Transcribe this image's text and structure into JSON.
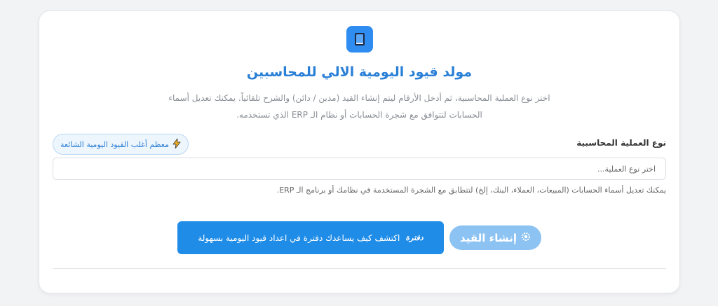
{
  "header": {
    "title": "مولد قيود اليومية الالي للمحاسبين",
    "description_line1": "اختر نوع العملية المحاسبية، ثم أدخل الأرقام ليتم إنشاء القيد (مدين / دائن) والشرح تلقائياً. يمكنك تعديل أسماء",
    "description_line2": "الحسابات لتتوافق مع شجرة الحسابات أو نظام الـ ERP الذي تستخدمه."
  },
  "form": {
    "field_label": "نوع العملية المحاسبية",
    "common_button_label": "معظم أغلب القيود اليومية الشائعة",
    "select_value": "اختر نوع العملية...",
    "hint": "يمكنك تعديل أسماء الحسابات (المبيعات، العملاء، البنك، إلخ) لتتطابق مع الشجرة المستخدمة في نظامك أو برنامج الـ ERP."
  },
  "actions": {
    "submit_label": "إنشاء القيد",
    "promo_brand": "دفترة",
    "promo_text": "اكتشف كيف يساعدك دفترة في اعداد قيود اليومية بسهولة"
  },
  "colors": {
    "accent": "#2f8cf0",
    "title": "#2a7fd6",
    "submit_bg": "#8cc3f2",
    "promo_bg": "#1f8ce8"
  },
  "icons": {
    "logo": "book-icon",
    "common": "lightning-icon",
    "submit": "gear-icon"
  }
}
